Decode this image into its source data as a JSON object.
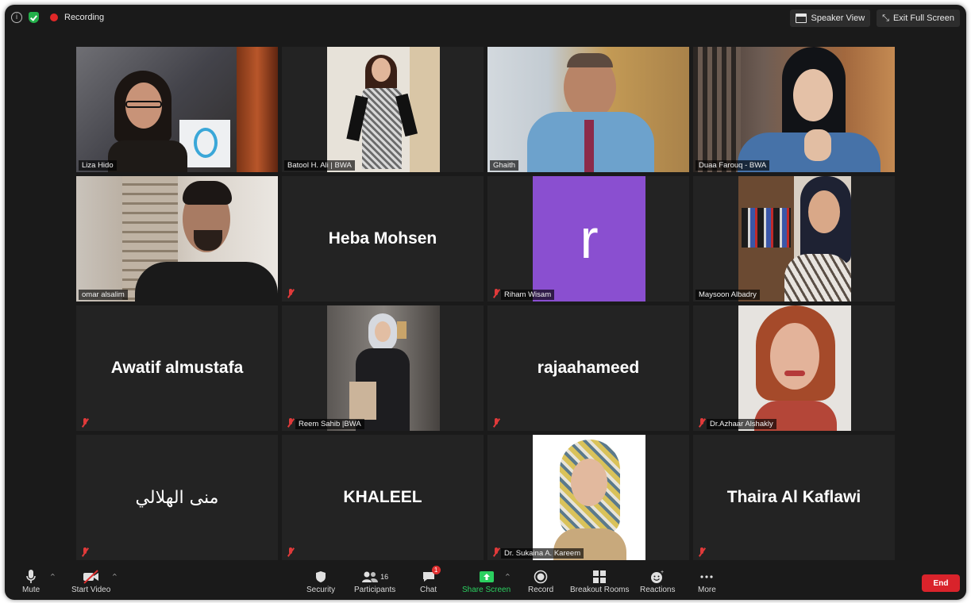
{
  "top_bar": {
    "recording_label": "Recording",
    "speaker_view_label": "Speaker View",
    "exit_full_screen_label": "Exit Full Screen"
  },
  "participants": [
    {
      "name": "Liza Hido",
      "display": "",
      "muted": false,
      "active_speaker": true
    },
    {
      "name": "Batool H. Ali | BWA",
      "display": "",
      "muted": false
    },
    {
      "name": "Ghaith",
      "display": "",
      "muted": false
    },
    {
      "name": "Duaa Farouq - BWA",
      "display": "",
      "muted": false
    },
    {
      "name": "omar alsalim",
      "display": "",
      "muted": false
    },
    {
      "name": "",
      "display": "Heba Mohsen",
      "muted": true
    },
    {
      "name": "Riham Wisam",
      "display": "r",
      "muted": true
    },
    {
      "name": "Maysoon Albadry",
      "display": "",
      "muted": false
    },
    {
      "name": "",
      "display": "Awatif almustafa",
      "muted": true
    },
    {
      "name": "Reem Sahib |BWA",
      "display": "",
      "muted": true
    },
    {
      "name": "",
      "display": "rajaahameed",
      "muted": true
    },
    {
      "name": "Dr.Azhaar Alshakly",
      "display": "",
      "muted": true
    },
    {
      "name": "",
      "display": "منى الهلالي",
      "muted": true
    },
    {
      "name": "",
      "display": "KHALEEL",
      "muted": true
    },
    {
      "name": "Dr. Sukaina A. Kareem",
      "display": "",
      "muted": true
    },
    {
      "name": "",
      "display": "Thaira Al Kaflawi",
      "muted": true
    }
  ],
  "toolbar": {
    "mute_label": "Mute",
    "start_video_label": "Start Video",
    "security_label": "Security",
    "participants_label": "Participants",
    "participants_count": "16",
    "chat_label": "Chat",
    "chat_badge": "1",
    "share_screen_label": "Share Screen",
    "record_label": "Record",
    "breakout_rooms_label": "Breakout Rooms",
    "reactions_label": "Reactions",
    "more_label": "More",
    "end_label": "End"
  },
  "colors": {
    "active_speaker_outline": "#b9d867",
    "share_screen": "#2bd060",
    "end_button": "#d9232b",
    "avatar_purple": "#8a4fd0"
  }
}
